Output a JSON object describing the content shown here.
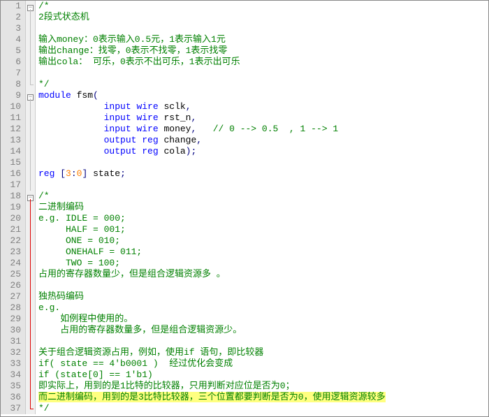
{
  "lines": [
    {
      "n": 1,
      "fold": "minus",
      "spans": [
        {
          "t": "/*",
          "c": "c-comment"
        }
      ]
    },
    {
      "n": 2,
      "fold": "line",
      "spans": [
        {
          "t": "2段式状态机",
          "c": "c-comment"
        }
      ]
    },
    {
      "n": 3,
      "fold": "line",
      "spans": [
        {
          "t": "",
          "c": ""
        }
      ]
    },
    {
      "n": 4,
      "fold": "line",
      "spans": [
        {
          "t": "输入money：0表示输入0.5元，1表示输入1元",
          "c": "c-comment"
        }
      ]
    },
    {
      "n": 5,
      "fold": "line",
      "spans": [
        {
          "t": "输出change：找零，0表示不找零，1表示找零",
          "c": "c-comment"
        }
      ]
    },
    {
      "n": 6,
      "fold": "line",
      "spans": [
        {
          "t": "输出cola： 可乐，0表示不出可乐，1表示出可乐",
          "c": "c-comment"
        }
      ]
    },
    {
      "n": 7,
      "fold": "line",
      "spans": [
        {
          "t": "",
          "c": ""
        }
      ]
    },
    {
      "n": 8,
      "fold": "end",
      "spans": [
        {
          "t": "*/",
          "c": "c-comment"
        }
      ]
    },
    {
      "n": 9,
      "fold": "minus",
      "spans": [
        {
          "t": "module",
          "c": "c-keyword"
        },
        {
          "t": " fsm",
          "c": "c-ident"
        },
        {
          "t": "(",
          "c": "c-punct"
        }
      ]
    },
    {
      "n": 10,
      "fold": "line",
      "indent": "            ",
      "spans": [
        {
          "t": "input",
          "c": "c-keyword"
        },
        {
          "t": " ",
          "c": ""
        },
        {
          "t": "wire",
          "c": "c-keyword"
        },
        {
          "t": " sclk",
          "c": "c-ident"
        },
        {
          "t": ",",
          "c": "c-punct"
        }
      ]
    },
    {
      "n": 11,
      "fold": "line",
      "indent": "            ",
      "spans": [
        {
          "t": "input",
          "c": "c-keyword"
        },
        {
          "t": " ",
          "c": ""
        },
        {
          "t": "wire",
          "c": "c-keyword"
        },
        {
          "t": " rst_n",
          "c": "c-ident"
        },
        {
          "t": ",",
          "c": "c-punct"
        }
      ]
    },
    {
      "n": 12,
      "fold": "line",
      "indent": "            ",
      "spans": [
        {
          "t": "input",
          "c": "c-keyword"
        },
        {
          "t": " ",
          "c": ""
        },
        {
          "t": "wire",
          "c": "c-keyword"
        },
        {
          "t": " money",
          "c": "c-ident"
        },
        {
          "t": ",",
          "c": "c-punct"
        },
        {
          "t": "   // 0 --> 0.5  , 1 --> 1",
          "c": "c-comment"
        }
      ]
    },
    {
      "n": 13,
      "fold": "line",
      "indent": "            ",
      "spans": [
        {
          "t": "output",
          "c": "c-keyword"
        },
        {
          "t": " ",
          "c": ""
        },
        {
          "t": "reg",
          "c": "c-keyword"
        },
        {
          "t": " change",
          "c": "c-ident"
        },
        {
          "t": ",",
          "c": "c-punct"
        }
      ]
    },
    {
      "n": 14,
      "fold": "line",
      "indent": "            ",
      "spans": [
        {
          "t": "output",
          "c": "c-keyword"
        },
        {
          "t": " ",
          "c": ""
        },
        {
          "t": "reg",
          "c": "c-keyword"
        },
        {
          "t": " cola",
          "c": "c-ident"
        },
        {
          "t": ");",
          "c": "c-punct"
        }
      ]
    },
    {
      "n": 15,
      "fold": "line",
      "spans": [
        {
          "t": "",
          "c": ""
        }
      ]
    },
    {
      "n": 16,
      "fold": "line",
      "spans": [
        {
          "t": "reg",
          "c": "c-keyword"
        },
        {
          "t": " ",
          "c": ""
        },
        {
          "t": "[",
          "c": "c-punct"
        },
        {
          "t": "3",
          "c": "c-num"
        },
        {
          "t": ":",
          "c": "c-punct"
        },
        {
          "t": "0",
          "c": "c-num"
        },
        {
          "t": "]",
          "c": "c-punct"
        },
        {
          "t": " state",
          "c": "c-ident"
        },
        {
          "t": ";",
          "c": "c-punct"
        }
      ]
    },
    {
      "n": 17,
      "fold": "line",
      "spans": [
        {
          "t": "",
          "c": ""
        }
      ]
    },
    {
      "n": 18,
      "fold": "minus-red",
      "spans": [
        {
          "t": "/*",
          "c": "c-comment"
        }
      ]
    },
    {
      "n": 19,
      "fold": "line-red",
      "spans": [
        {
          "t": "二进制编码",
          "c": "c-comment"
        }
      ]
    },
    {
      "n": 20,
      "fold": "line-red",
      "spans": [
        {
          "t": "e.g. IDLE = 000;",
          "c": "c-comment"
        }
      ]
    },
    {
      "n": 21,
      "fold": "line-red",
      "spans": [
        {
          "t": "     HALF = 001;",
          "c": "c-comment"
        }
      ]
    },
    {
      "n": 22,
      "fold": "line-red",
      "spans": [
        {
          "t": "     ONE = 010;",
          "c": "c-comment"
        }
      ]
    },
    {
      "n": 23,
      "fold": "line-red",
      "spans": [
        {
          "t": "     ONEHALF = 011;",
          "c": "c-comment"
        }
      ]
    },
    {
      "n": 24,
      "fold": "line-red",
      "spans": [
        {
          "t": "     TWO = 100;",
          "c": "c-comment"
        }
      ]
    },
    {
      "n": 25,
      "fold": "line-red",
      "spans": [
        {
          "t": "占用的寄存器数量少，但是组合逻辑资源多 。",
          "c": "c-comment"
        }
      ]
    },
    {
      "n": 26,
      "fold": "line-red",
      "spans": [
        {
          "t": "",
          "c": ""
        }
      ]
    },
    {
      "n": 27,
      "fold": "line-red",
      "spans": [
        {
          "t": "独热码编码",
          "c": "c-comment"
        }
      ]
    },
    {
      "n": 28,
      "fold": "line-red",
      "spans": [
        {
          "t": "e.g.",
          "c": "c-comment"
        }
      ]
    },
    {
      "n": 29,
      "fold": "line-red",
      "spans": [
        {
          "t": "    如例程中使用的。",
          "c": "c-comment"
        }
      ]
    },
    {
      "n": 30,
      "fold": "line-red",
      "spans": [
        {
          "t": "    占用的寄存器数量多，但是组合逻辑资源少。",
          "c": "c-comment"
        }
      ]
    },
    {
      "n": 31,
      "fold": "line-red",
      "spans": [
        {
          "t": "",
          "c": ""
        }
      ]
    },
    {
      "n": 32,
      "fold": "line-red",
      "spans": [
        {
          "t": "关于组合逻辑资源占用，例如，使用if 语句，即比较器",
          "c": "c-comment"
        }
      ]
    },
    {
      "n": 33,
      "fold": "line-red",
      "spans": [
        {
          "t": "if( state == 4'b0001 )  经过优化会变成",
          "c": "c-comment"
        }
      ]
    },
    {
      "n": 34,
      "fold": "line-red",
      "spans": [
        {
          "t": "if (state[0] == 1'b1)",
          "c": "c-comment"
        }
      ]
    },
    {
      "n": 35,
      "fold": "line-red",
      "spans": [
        {
          "t": "即实际上，用到的是1比特的比较器，只用判断对应位是否为0；",
          "c": "c-comment"
        }
      ]
    },
    {
      "n": 36,
      "fold": "line-red",
      "spans": [
        {
          "t": "而二进制编码，用到的是3比特比较器，三个位置都要判断是否为0，使用逻辑资源较多",
          "c": "c-comment hl"
        }
      ]
    },
    {
      "n": 37,
      "fold": "end-red",
      "spans": [
        {
          "t": "*/",
          "c": "c-comment"
        }
      ]
    }
  ]
}
